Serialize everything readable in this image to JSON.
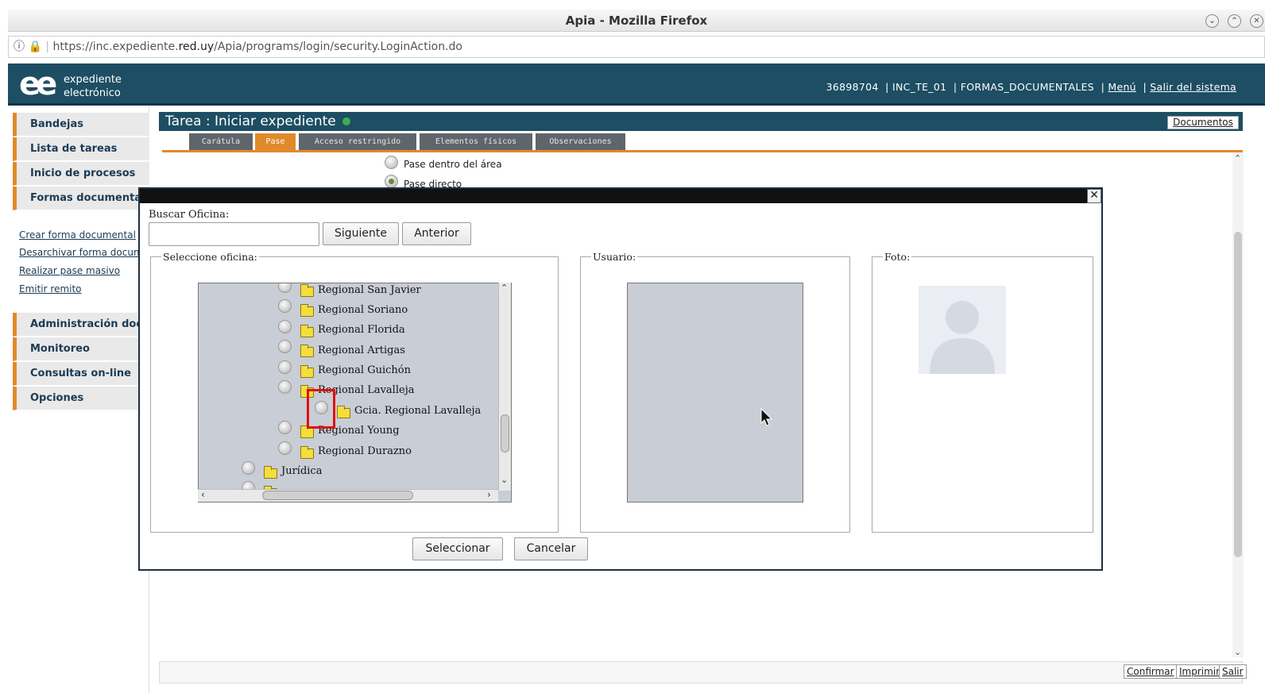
{
  "browser": {
    "title": "Apia - Mozilla Firefox",
    "url_prefix": "https://inc.expediente.",
    "url_domain": "red.uy",
    "url_path": "/Apia/programs/login/security.LoginAction.do"
  },
  "header": {
    "logo_mark": "ee",
    "logo_line1": "expediente",
    "logo_line2": "electrónico",
    "user_id": "36898704",
    "env": "INC_TE_01",
    "profile": "FORMAS_DOCUMENTALES",
    "menu_link": "Menú",
    "logout_link": "Salir del sistema",
    "separator": "|"
  },
  "sidebar": {
    "items": [
      {
        "label": "Bandejas"
      },
      {
        "label": "Lista de tareas"
      },
      {
        "label": "Inicio de procesos"
      },
      {
        "label": "Formas documentales"
      }
    ],
    "links": [
      {
        "label": "Crear forma documental"
      },
      {
        "label": "Desarchivar forma documental"
      },
      {
        "label": "Realizar pase masivo"
      },
      {
        "label": "Emitir remito"
      }
    ],
    "items2": [
      {
        "label": "Administración documental"
      },
      {
        "label": "Monitoreo"
      },
      {
        "label": "Consultas on-line"
      },
      {
        "label": "Opciones"
      }
    ]
  },
  "task": {
    "title": "Tarea : Iniciar expediente",
    "documents_button": "Documentos",
    "tabs": [
      {
        "label": "Carátula"
      },
      {
        "label": "Pase"
      },
      {
        "label": "Acceso restringido"
      },
      {
        "label": "Elementos físicos"
      },
      {
        "label": "Observaciones"
      }
    ],
    "active_tab": "Pase",
    "pase_options": [
      {
        "label": "Pase dentro del área",
        "selected": false
      },
      {
        "label": "Pase directo",
        "selected": true
      }
    ],
    "bottom_buttons": {
      "confirm": "Confirmar",
      "print": "Imprimir",
      "exit": "Salir"
    }
  },
  "dialog": {
    "search_label": "Buscar Oficina:",
    "search_value": "",
    "next_button": "Siguiente",
    "prev_button": "Anterior",
    "office_legend": "Seleccione oficina:",
    "user_legend": "Usuario:",
    "photo_legend": "Foto:",
    "tree": [
      {
        "label": "Regional San Javier"
      },
      {
        "label": "Regional Soriano"
      },
      {
        "label": "Regional Florida"
      },
      {
        "label": "Regional Artigas"
      },
      {
        "label": "Regional Guichón"
      },
      {
        "label": "Regional Lavalleja"
      },
      {
        "label": "Gcia. Regional Lavalleja"
      },
      {
        "label": "Regional Young"
      },
      {
        "label": "Regional Durazno"
      },
      {
        "label": "Jurídica"
      }
    ],
    "select_button": "Seleccionar",
    "cancel_button": "Cancelar"
  },
  "colors": {
    "header": "#1d4e63",
    "accent": "#e08a2c",
    "tree_bg": "#c9cdd6",
    "highlight": "#e01010",
    "status_dot": "#3db04a"
  }
}
